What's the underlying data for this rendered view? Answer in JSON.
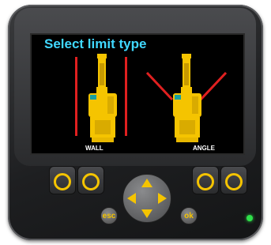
{
  "screen": {
    "title": "Select limit type",
    "options": [
      {
        "label": "WALL"
      },
      {
        "label": "ANGLE"
      }
    ]
  },
  "controls": {
    "esc_label": "esc",
    "ok_label": "ok"
  },
  "colors": {
    "title": "#40d8ff",
    "accent": "#f5c400",
    "limit_line": "#e02020",
    "led": "#2fe04a"
  }
}
